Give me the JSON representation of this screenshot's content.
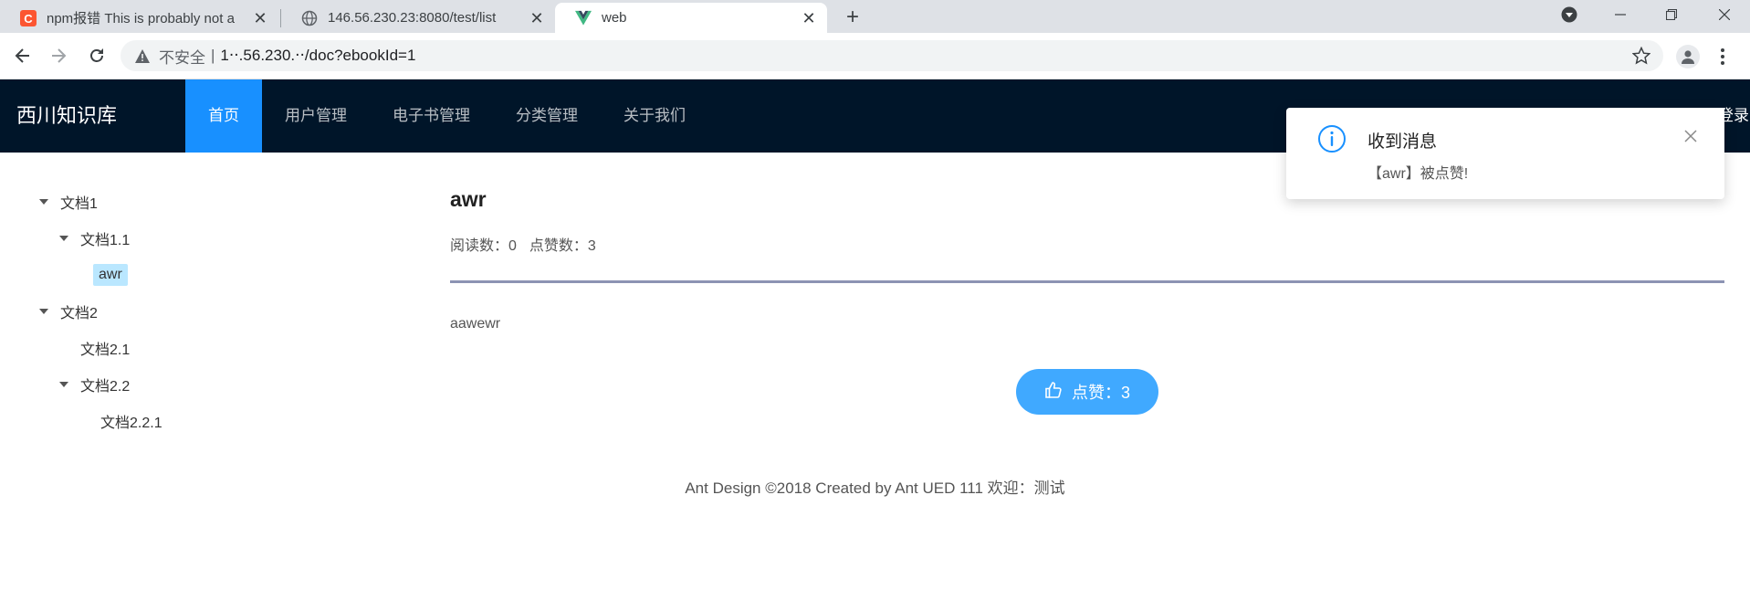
{
  "browser": {
    "tabs": [
      {
        "title": "npm报错 This is probably not a",
        "favicon": "csdn-icon"
      },
      {
        "title": "146.56.230.23:8080/test/list",
        "favicon": "globe-icon"
      },
      {
        "title": "web",
        "favicon": "vue-icon"
      }
    ],
    "new_tab_symbol": "+",
    "address": {
      "security_text": "不安全",
      "separator": "|",
      "url": "1‧‧.56.230.‧‧/doc?ebookId=1"
    }
  },
  "app": {
    "logo": "西川知识库",
    "menu": [
      {
        "label": "首页",
        "active": true
      },
      {
        "label": "用户管理",
        "active": false
      },
      {
        "label": "电子书管理",
        "active": false
      },
      {
        "label": "分类管理",
        "active": false
      },
      {
        "label": "关于我们",
        "active": false
      }
    ],
    "login_text": "登录"
  },
  "tree": [
    {
      "label": "文档1",
      "level": 0,
      "expanded": true
    },
    {
      "label": "文档1.1",
      "level": 1,
      "expanded": true
    },
    {
      "label": "awr",
      "level": 2,
      "selected": true
    },
    {
      "label": "文档2",
      "level": 0,
      "expanded": true
    },
    {
      "label": "文档2.1",
      "level": 1
    },
    {
      "label": "文档2.2",
      "level": 1,
      "expanded": true
    },
    {
      "label": "文档2.2.1",
      "level": 2
    }
  ],
  "doc": {
    "title": "awr",
    "view_count_label": "阅读数：0",
    "vote_count_label": "点赞数：3",
    "body": "aawewr",
    "vote_button_label": "点赞：3"
  },
  "footer": {
    "text": "Ant Design ©2018 Created by Ant UED 111 欢迎：测试"
  },
  "notification": {
    "title": "收到消息",
    "description": "【awr】被点赞!"
  },
  "colors": {
    "header_bg": "#001529",
    "menu_active": "#1890ff",
    "vote_button": "#40a9ff",
    "tree_selected": "#bae7ff",
    "info_icon": "#1890ff"
  }
}
